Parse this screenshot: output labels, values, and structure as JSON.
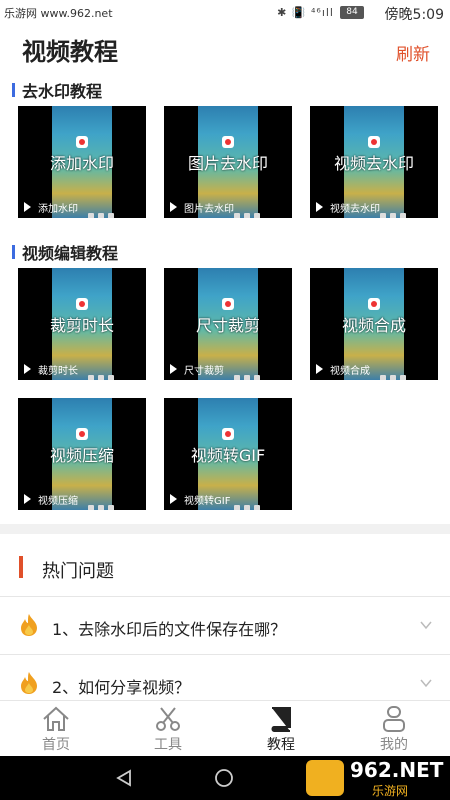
{
  "status_bar": {
    "watermark": "乐游网 www.962.net",
    "icons": "✱ 📳 ⁴⁶ıll",
    "battery": "84",
    "time": "傍晚5:09"
  },
  "header": {
    "title": "视频教程",
    "refresh": "刷新"
  },
  "sections": [
    {
      "title": "去水印教程",
      "items": [
        {
          "label": "添加水印",
          "caption": "添加水印"
        },
        {
          "label": "图片去水印",
          "caption": "图片去水印"
        },
        {
          "label": "视频去水印",
          "caption": "视频去水印"
        }
      ]
    },
    {
      "title": "视频编辑教程",
      "items": [
        {
          "label": "裁剪时长",
          "caption": "裁剪时长"
        },
        {
          "label": "尺寸裁剪",
          "caption": "尺寸裁剪"
        },
        {
          "label": "视频合成",
          "caption": "视频合成"
        },
        {
          "label": "视频压缩",
          "caption": "视频压缩"
        },
        {
          "label": "视频转GIF",
          "caption": "视频转GIF"
        }
      ]
    }
  ],
  "hot": {
    "title": "热门问题",
    "questions": [
      "1、去除水印后的文件保存在哪？",
      "2、如何分享视频？"
    ]
  },
  "nav": [
    {
      "label": "首页",
      "icon": "home-icon",
      "active": false
    },
    {
      "label": "工具",
      "icon": "scissors-icon",
      "active": false
    },
    {
      "label": "教程",
      "icon": "book-icon",
      "active": true
    },
    {
      "label": "我的",
      "icon": "profile-icon",
      "active": false
    }
  ],
  "brand": {
    "text": "962.NET",
    "sub": "乐游网"
  },
  "colors": {
    "accent": "#e0502a",
    "section_bar": "#3c6be0",
    "active_nav": "#222222"
  }
}
